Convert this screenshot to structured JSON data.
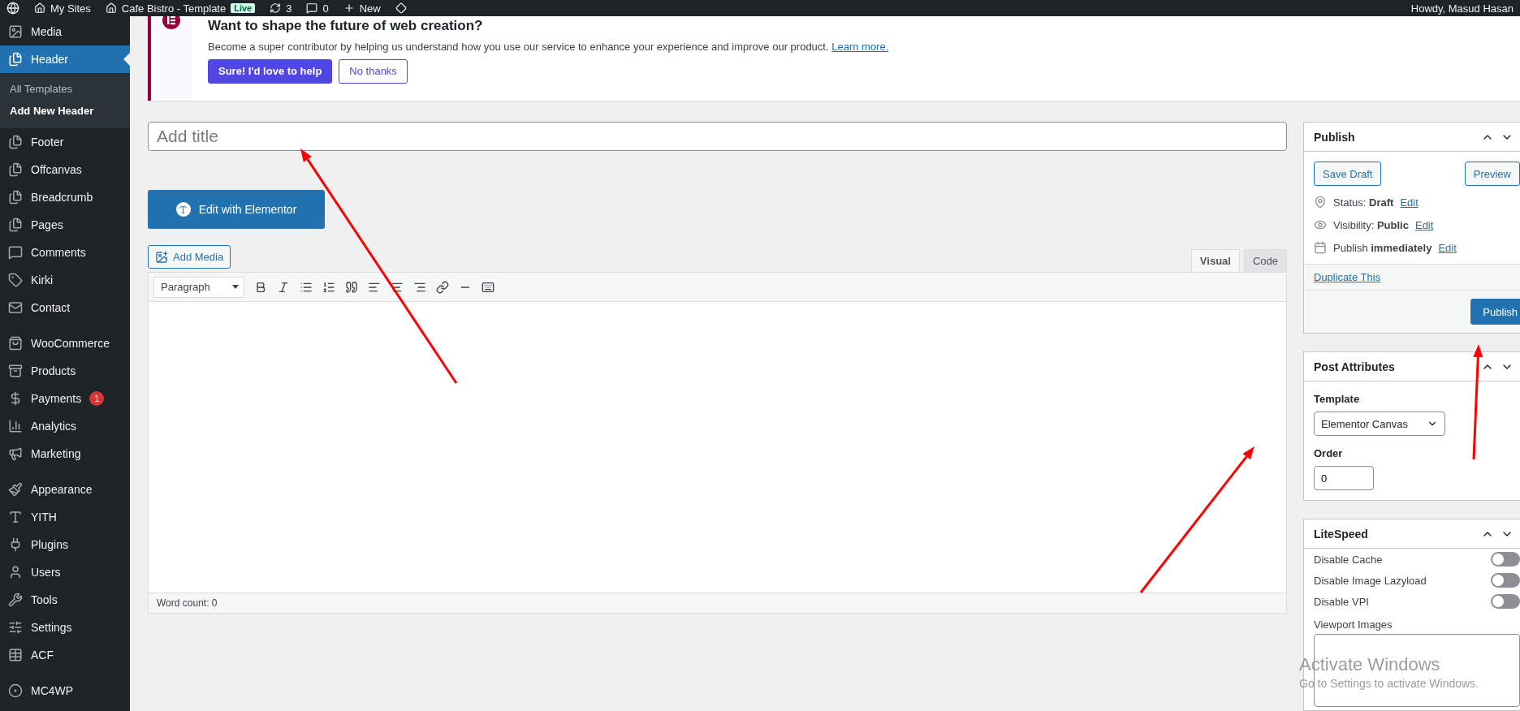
{
  "admin_bar": {
    "sites": "My Sites",
    "site": "Cafe Bistro - Template",
    "live_badge": "Live",
    "updates": "3",
    "comments": "0",
    "new": "New",
    "greeting": "Howdy, Masud Hasan"
  },
  "sidebar": {
    "groups": [
      {
        "items": [
          {
            "label": "Media",
            "selected": false
          },
          {
            "label": "Header",
            "selected": true,
            "children": [
              {
                "label": "All Templates",
                "selected": false
              },
              {
                "label": "Add New Header",
                "selected": true
              }
            ]
          },
          {
            "label": "Footer",
            "selected": false
          },
          {
            "label": "Offcanvas",
            "selected": false
          },
          {
            "label": "Breadcrumb",
            "selected": false
          },
          {
            "label": "Pages",
            "selected": false
          },
          {
            "label": "Comments",
            "selected": false
          },
          {
            "label": "Kirki",
            "selected": false
          },
          {
            "label": "Contact",
            "selected": false
          }
        ]
      },
      {
        "items": [
          {
            "label": "WooCommerce",
            "selected": false
          },
          {
            "label": "Products",
            "selected": false
          },
          {
            "label": "Payments",
            "selected": false,
            "badge": "1"
          },
          {
            "label": "Analytics",
            "selected": false
          },
          {
            "label": "Marketing",
            "selected": false
          }
        ]
      },
      {
        "items": [
          {
            "label": "Appearance",
            "selected": false
          },
          {
            "label": "YITH",
            "selected": false
          },
          {
            "label": "Plugins",
            "selected": false
          },
          {
            "label": "Users",
            "selected": false
          },
          {
            "label": "Tools",
            "selected": false
          },
          {
            "label": "Settings",
            "selected": false
          },
          {
            "label": "ACF",
            "selected": false
          }
        ]
      },
      {
        "items": [
          {
            "label": "MC4WP",
            "selected": false
          }
        ]
      }
    ]
  },
  "notice": {
    "title": "Want to shape the future of web creation?",
    "text": "Become a super contributor by helping us understand how you use our service to enhance your experience and improve our product.",
    "link": "Learn more.",
    "buttons": [
      {
        "label": "Sure! I'd love to help",
        "kind": "primary"
      },
      {
        "label": "No thanks",
        "kind": "secondary"
      }
    ]
  },
  "editor": {
    "title_placeholder": "Add title",
    "elementor_button": "Edit with Elementor",
    "add_media": "Add Media",
    "tabs": [
      {
        "label": "Visual",
        "selected": true
      },
      {
        "label": "Code",
        "selected": false
      }
    ],
    "format_select": "Paragraph",
    "word_count": "Word count: 0"
  },
  "publish": {
    "title": "Publish",
    "save_draft": "Save Draft",
    "preview": "Preview",
    "rows": [
      {
        "text": "Status: **Draft**",
        "link": "Edit"
      },
      {
        "text": "Visibility: **Public**",
        "link": "Edit"
      },
      {
        "text": "Publish **immediately**",
        "link": "Edit"
      }
    ],
    "duplicate": "Duplicate This",
    "publish_button": "Publish"
  },
  "post_attributes": {
    "title": "Post Attributes",
    "template_label": "Template",
    "template_value": "Elementor Canvas",
    "order_label": "Order",
    "order_value": "0"
  },
  "litespeed": {
    "title": "LiteSpeed",
    "toggles": [
      {
        "label": "Disable Cache",
        "on": false
      },
      {
        "label": "Disable Image Lazyload",
        "on": false
      },
      {
        "label": "Disable VPI",
        "on": false
      }
    ],
    "viewport_label": "Viewport Images"
  },
  "os_watermark": {
    "title": "Activate Windows",
    "text": "Go to Settings to activate Windows."
  }
}
